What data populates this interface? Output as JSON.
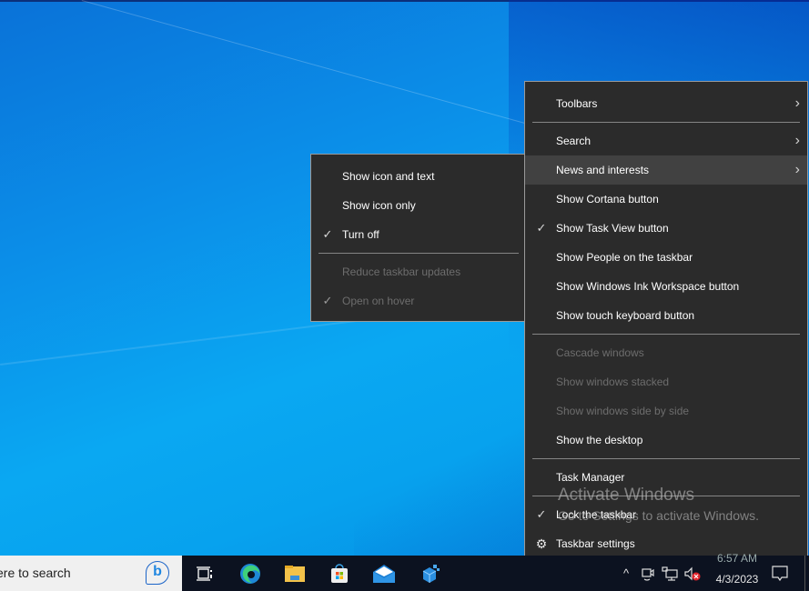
{
  "main_menu": {
    "items": [
      {
        "label": "Toolbars",
        "submenu": true,
        "checked": false,
        "disabled": false
      },
      {
        "separator": true
      },
      {
        "label": "Search",
        "submenu": true,
        "checked": false,
        "disabled": false
      },
      {
        "label": "News and interests",
        "submenu": true,
        "checked": false,
        "disabled": false,
        "highlighted": true
      },
      {
        "label": "Show Cortana button",
        "checked": false,
        "disabled": false
      },
      {
        "label": "Show Task View button",
        "checked": true,
        "disabled": false
      },
      {
        "label": "Show People on the taskbar",
        "checked": false,
        "disabled": false
      },
      {
        "label": "Show Windows Ink Workspace button",
        "checked": false,
        "disabled": false
      },
      {
        "label": "Show touch keyboard button",
        "checked": false,
        "disabled": false
      },
      {
        "separator": true
      },
      {
        "label": "Cascade windows",
        "disabled": true
      },
      {
        "label": "Show windows stacked",
        "disabled": true
      },
      {
        "label": "Show windows side by side",
        "disabled": true
      },
      {
        "label": "Show the desktop",
        "disabled": false
      },
      {
        "separator": true
      },
      {
        "label": "Task Manager",
        "disabled": false
      },
      {
        "separator": true
      },
      {
        "label": "Lock the taskbar",
        "checked": true,
        "disabled": false
      },
      {
        "label": "Taskbar settings",
        "icon": "gear-icon",
        "disabled": false
      }
    ]
  },
  "sub_menu": {
    "items": [
      {
        "label": "Show icon and text",
        "checked": false,
        "disabled": false
      },
      {
        "label": "Show icon only",
        "checked": false,
        "disabled": false
      },
      {
        "label": "Turn off",
        "checked": true,
        "disabled": false
      },
      {
        "separator": true
      },
      {
        "label": "Reduce taskbar updates",
        "checked": false,
        "disabled": true
      },
      {
        "label": "Open on hover",
        "checked": true,
        "disabled": true
      }
    ]
  },
  "watermark": {
    "title": "Activate Windows",
    "subtitle": "Go to Settings to activate Windows."
  },
  "taskbar": {
    "search_text": "ere to search",
    "apps": [
      "task-view",
      "edge",
      "file-explorer",
      "microsoft-store",
      "mail",
      "3d-app"
    ],
    "clock": {
      "time": "6:57 AM",
      "date": "4/3/2023"
    }
  },
  "glyphs": {
    "check": "✓",
    "chevron": "›",
    "gear": "⚙",
    "bing": "b",
    "tray_chevron": "^"
  }
}
